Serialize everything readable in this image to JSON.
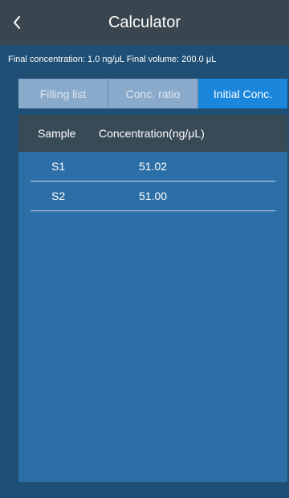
{
  "header": {
    "title": "Calculator"
  },
  "info": {
    "text": "Final concentration: 1.0 ng/μL  Final volume: 200.0 μL"
  },
  "tabs": [
    {
      "label": "Filling list",
      "active": false
    },
    {
      "label": "Conc. ratio",
      "active": false
    },
    {
      "label": "Initial Conc.",
      "active": true
    }
  ],
  "table": {
    "headers": [
      "Sample",
      "Concentration(ng/μL)"
    ],
    "rows": [
      {
        "sample": "S1",
        "concentration": "51.02"
      },
      {
        "sample": "S2",
        "concentration": "51.00"
      }
    ]
  },
  "colors": {
    "background": "#1f4f74",
    "header_bar": "#39464f",
    "tab_active": "#1a86dc",
    "tab_inactive": "#8aaacb",
    "panel": "#2c6ea6",
    "table_header": "#394a57"
  },
  "icons": {
    "back": "chevron-left-icon"
  }
}
